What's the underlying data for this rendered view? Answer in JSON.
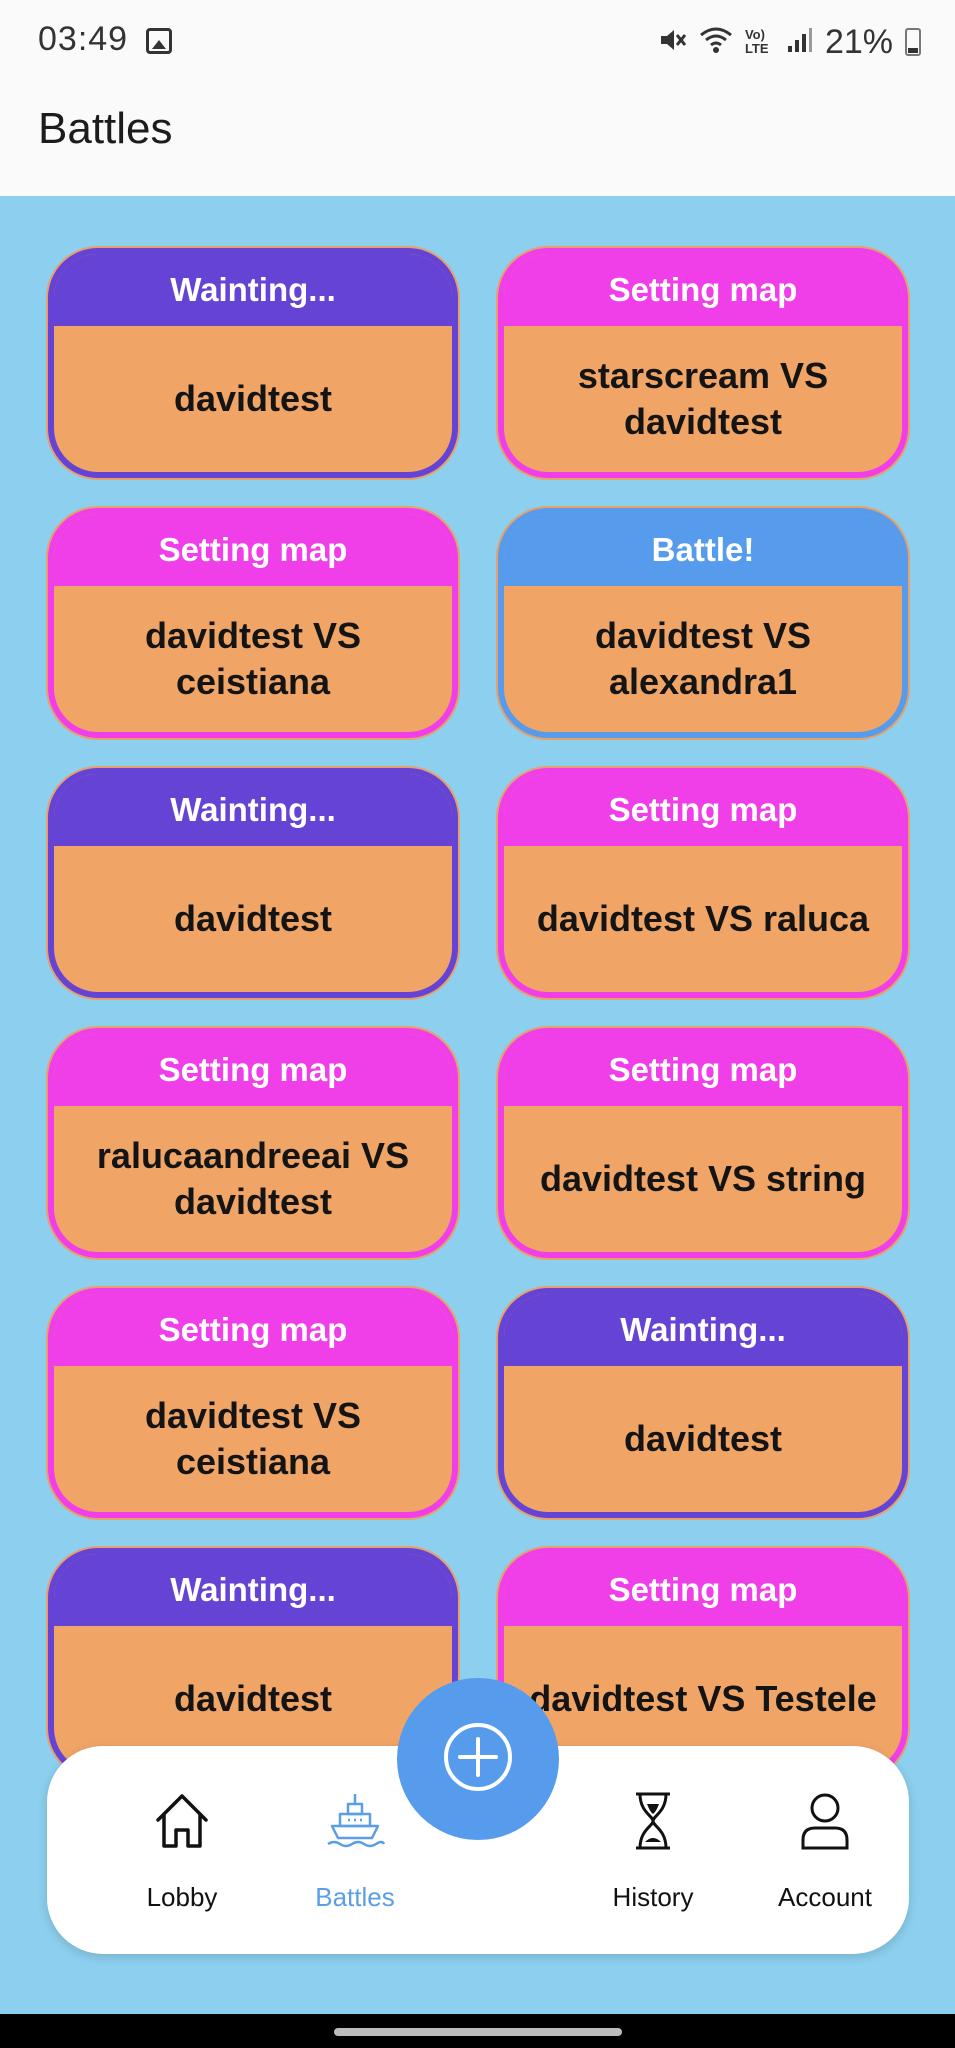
{
  "status_bar": {
    "time": "03:49",
    "lte_label": "Vo) LTE",
    "battery": "21%"
  },
  "header": {
    "title": "Battles"
  },
  "battles": [
    {
      "status": "Wainting...",
      "status_type": "waiting",
      "players": "davidtest"
    },
    {
      "status": "Setting map",
      "status_type": "map",
      "players": "starscream VS davidtest"
    },
    {
      "status": "Setting map",
      "status_type": "map",
      "players": "davidtest VS ceistiana"
    },
    {
      "status": "Battle!",
      "status_type": "battle",
      "players": "davidtest VS alexandra1"
    },
    {
      "status": "Wainting...",
      "status_type": "waiting",
      "players": "davidtest"
    },
    {
      "status": "Setting map",
      "status_type": "map",
      "players": "davidtest VS raluca"
    },
    {
      "status": "Setting map",
      "status_type": "map",
      "players": "ralucaandreeai VS davidtest"
    },
    {
      "status": "Setting map",
      "status_type": "map",
      "players": "davidtest VS string"
    },
    {
      "status": "Setting map",
      "status_type": "map",
      "players": "davidtest VS ceistiana"
    },
    {
      "status": "Wainting...",
      "status_type": "waiting",
      "players": "davidtest"
    },
    {
      "status": "Wainting...",
      "status_type": "waiting",
      "players": "davidtest"
    },
    {
      "status": "Setting map",
      "status_type": "map",
      "players": "davidtest VS Testele"
    }
  ],
  "bottom_nav": {
    "items": [
      {
        "label": "Lobby",
        "icon": "home-icon"
      },
      {
        "label": "Battles",
        "icon": "ship-icon",
        "active": true
      },
      {
        "label": "History",
        "icon": "hourglass-icon"
      },
      {
        "label": "Account",
        "icon": "user-icon"
      }
    ],
    "fab_icon": "add-circle-icon"
  },
  "colors": {
    "background": "#8ccfee",
    "card_body": "#f0a567",
    "waiting": "#6543d4",
    "setting_map": "#f03fe9",
    "battle": "#579cec",
    "active_nav": "#5b9ee6"
  }
}
